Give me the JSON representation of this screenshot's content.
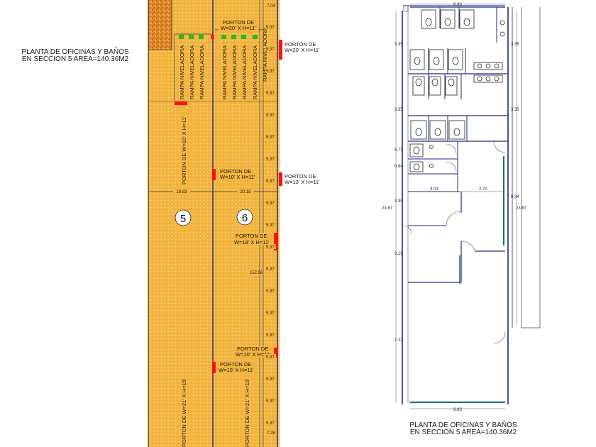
{
  "caption_left": {
    "line1": "PLANTA DE OFICINAS Y BAÑOS",
    "line2": "EN SECCION 5 AREA=140.36M2"
  },
  "caption_right": {
    "line1": "PLANTA DE OFICINAS Y BAÑOS",
    "line2": "EN SECCION 5 AREA=140.36M2"
  },
  "doors": {
    "top_inner": {
      "line1": "PORTON DE",
      "line2": "W=20' X H=11'"
    },
    "top_right": {
      "line1": "PORTON DE",
      "line2": "W=20' X H=11'"
    },
    "mid_inner": {
      "line1": "PORTON DE",
      "line2": "W=10' X H=11'"
    },
    "mid_right": {
      "line1": "PORTON DE",
      "line2": "W=13' X H=11'"
    },
    "right_18": {
      "line1": "PORTON DE",
      "line2": "W=18' X H=11'"
    },
    "low_right": {
      "line1": "PORTON DE",
      "line2": "W=10' X H=11'"
    },
    "low_inner": {
      "line1": "PORTON DE",
      "line2": "W=10' X H=11'"
    },
    "vertical_upper": "PORTON DE W=10' X H=11'",
    "vertical_bottom_left": "PORTON DE W=21' X H=15'",
    "vertical_bottom_right": "PORTON DE W=21' X H=15'"
  },
  "ramp_label": "RAMPA NIVELADORA",
  "sections": {
    "left": "5",
    "right": "6"
  },
  "dims_left": {
    "span_left": "19.83",
    "span_right": "20.15",
    "long": "152.56",
    "top_edge": "7.04",
    "small": [
      "5.37",
      "5.37",
      "5.37",
      "5.37",
      "5.37",
      "5.37",
      "5.37",
      "5.37",
      "5.37",
      "5.37",
      "5.37",
      "5.37",
      "5.37",
      "5.37",
      "5.37",
      "5.37",
      "5.37",
      "5.37",
      "5.37"
    ],
    "bottom": "7.28"
  },
  "dims_right": {
    "top": "6.93",
    "bottom": "6.93",
    "left_stack": [
      "3.35",
      "3.35",
      "0.73",
      "0.94",
      "3.30",
      "3.19",
      "7.22"
    ],
    "total_left": "23.67",
    "total_right": "23.67",
    "right_stack": [
      "3.35",
      "3.35",
      "6.34"
    ],
    "mid_a": "3.03",
    "mid_b": "2.70"
  }
}
